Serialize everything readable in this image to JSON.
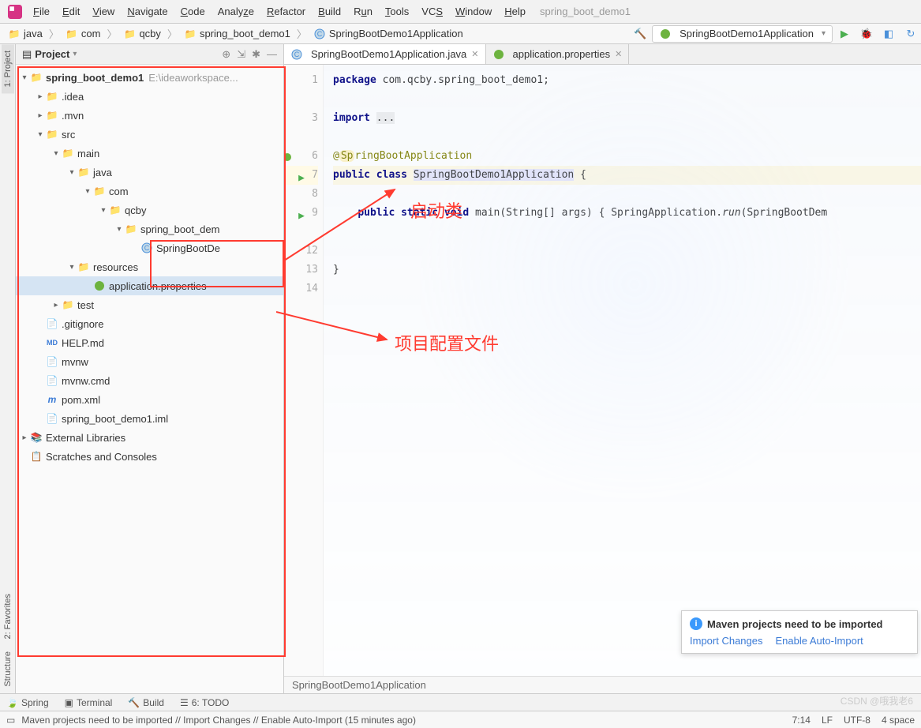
{
  "window": {
    "project_name": "spring_boot_demo1"
  },
  "menu": {
    "file": "File",
    "edit": "Edit",
    "view": "View",
    "navigate": "Navigate",
    "code": "Code",
    "analyze": "Analyze",
    "refactor": "Refactor",
    "build": "Build",
    "run": "Run",
    "tools": "Tools",
    "vcs": "VCS",
    "window": "Window",
    "help": "Help"
  },
  "breadcrumbs": {
    "b0": "java",
    "b1": "com",
    "b2": "qcby",
    "b3": "spring_boot_demo1",
    "b4": "SpringBootDemo1Application"
  },
  "run_config": {
    "name": "SpringBootDemo1Application"
  },
  "panel": {
    "title": "Project",
    "root": "spring_boot_demo1",
    "root_path": "E:\\ideaworkspace...",
    "idea": ".idea",
    "mvn": ".mvn",
    "src": "src",
    "main": "main",
    "java": "java",
    "com": "com",
    "qcby": "qcby",
    "pkg": "spring_boot_dem",
    "app_class": "SpringBootDe",
    "resources": "resources",
    "app_props": "application.properties",
    "test": "test",
    "gitignore": ".gitignore",
    "help": "HELP.md",
    "mvnw": "mvnw",
    "mvnwcmd": "mvnw.cmd",
    "pom": "pom.xml",
    "iml": "spring_boot_demo1.iml",
    "extlib": "External Libraries",
    "scratches": "Scratches and Consoles"
  },
  "tabs": {
    "t0": "SpringBootDemo1Application.java",
    "t1": "application.properties"
  },
  "code": {
    "l1": "package com.qcby.spring_boot_demo1;",
    "l3_a": "import ",
    "l3_b": "...",
    "l6": "@SpringBootApplication",
    "l7_a": "public class ",
    "l7_b": "SpringBootDemo1Application",
    "l7_c": " {",
    "l9_a": "    public static void ",
    "l9_b": "main",
    "l9_c": "(String[] args) { SpringApplication.",
    "l9_d": "run",
    "l9_e": "(SpringBootDem",
    "l13": "}",
    "lines": {
      "n1": "1",
      "n3": "3",
      "n6": "6",
      "n7": "7",
      "n8": "8",
      "n9": "9",
      "n12": "12",
      "n13": "13",
      "n14": "14"
    }
  },
  "editor_breadcrumb": "SpringBootDemo1Application",
  "popup": {
    "title": "Maven projects need to be imported",
    "link1": "Import Changes",
    "link2": "Enable Auto-Import"
  },
  "annotations": {
    "a1": "启动类",
    "a2": "项目配置文件"
  },
  "bottom_tools": {
    "spring": "Spring",
    "terminal": "Terminal",
    "build": "Build",
    "todo": "6: TODO"
  },
  "leftbar": {
    "project": "1: Project",
    "favorites": "2: Favorites",
    "structure": "Structure"
  },
  "statusbar": {
    "msg": "Maven projects need to be imported // Import Changes // Enable Auto-Import (15 minutes ago)",
    "pos": "7:14",
    "sep": "LF",
    "enc": "UTF-8",
    "indent": "4 space"
  },
  "watermark": "CSDN @哦我老6"
}
